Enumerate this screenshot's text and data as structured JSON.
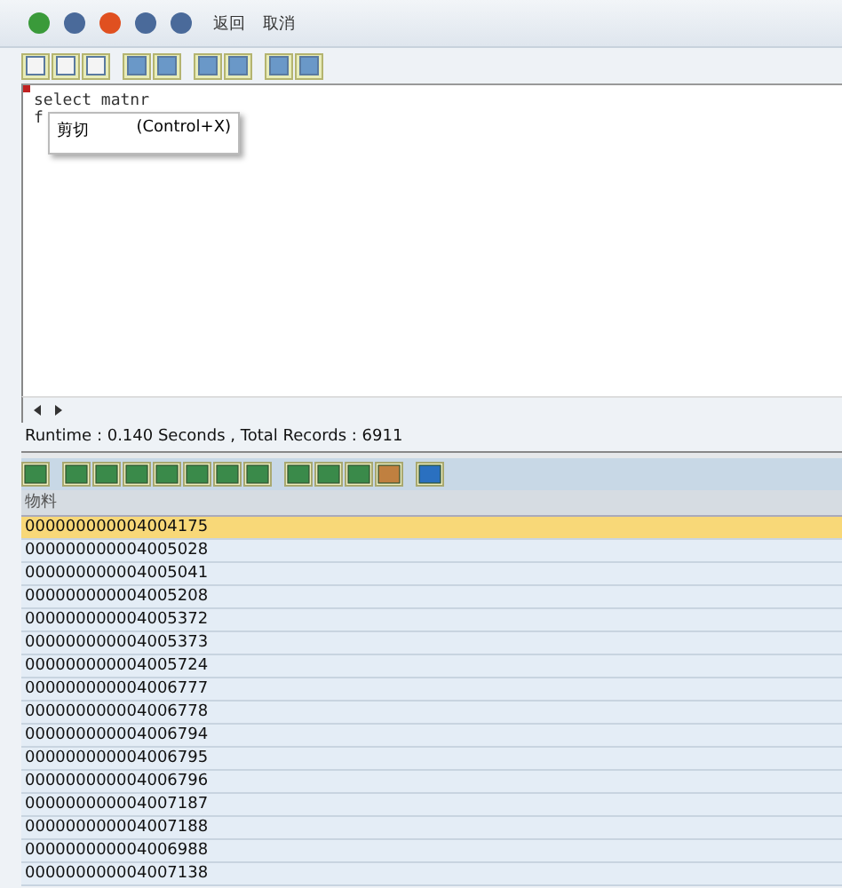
{
  "top_toolbar": {
    "buttons": [
      "返回",
      "取消"
    ]
  },
  "editor": {
    "lines": [
      "select matnr",
      "f"
    ]
  },
  "context_menu": {
    "label": "剪切",
    "shortcut": "(Control+X)"
  },
  "status": "Runtime : 0.140  Seconds , Total Records : 6911",
  "table": {
    "columns": [
      "物料"
    ],
    "rows": [
      {
        "cells": [
          "000000000004004175"
        ],
        "selected": true
      },
      {
        "cells": [
          "000000000004005028"
        ],
        "selected": false
      },
      {
        "cells": [
          "000000000004005041"
        ],
        "selected": false
      },
      {
        "cells": [
          "000000000004005208"
        ],
        "selected": false
      },
      {
        "cells": [
          "000000000004005372"
        ],
        "selected": false
      },
      {
        "cells": [
          "000000000004005373"
        ],
        "selected": false
      },
      {
        "cells": [
          "000000000004005724"
        ],
        "selected": false
      },
      {
        "cells": [
          "000000000004006777"
        ],
        "selected": false
      },
      {
        "cells": [
          "000000000004006778"
        ],
        "selected": false
      },
      {
        "cells": [
          "000000000004006794"
        ],
        "selected": false
      },
      {
        "cells": [
          "000000000004006795"
        ],
        "selected": false
      },
      {
        "cells": [
          "000000000004006796"
        ],
        "selected": false
      },
      {
        "cells": [
          "000000000004007187"
        ],
        "selected": false
      },
      {
        "cells": [
          "000000000004007188"
        ],
        "selected": false
      },
      {
        "cells": [
          "000000000004006988"
        ],
        "selected": false
      },
      {
        "cells": [
          "000000000004007138"
        ],
        "selected": false
      }
    ]
  }
}
